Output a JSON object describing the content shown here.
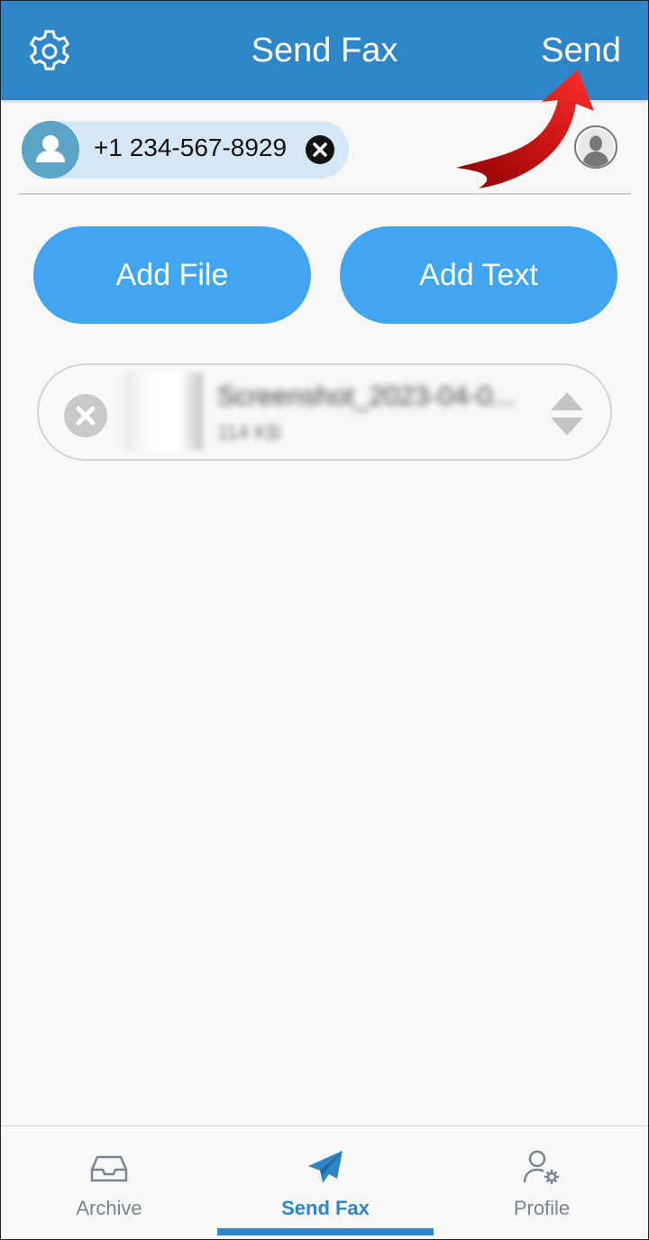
{
  "header": {
    "title": "Send Fax",
    "send_label": "Send",
    "settings_icon": "gear-icon"
  },
  "recipient": {
    "number": "+1 234-567-8929",
    "avatar_icon": "person-icon",
    "remove_icon": "close-icon",
    "contacts_icon": "contact-silhouette-icon"
  },
  "actions": {
    "add_file_label": "Add File",
    "add_text_label": "Add Text"
  },
  "attachments": [
    {
      "name": "Screenshot_2023-04-0...",
      "size": "114 KB",
      "remove_icon": "close-circle-icon",
      "reorder_icon": "reorder-arrows-icon"
    }
  ],
  "bottom_nav": {
    "items": [
      {
        "label": "Archive",
        "icon": "inbox-tray-icon",
        "active": false
      },
      {
        "label": "Send Fax",
        "icon": "paper-plane-icon",
        "active": true
      },
      {
        "label": "Profile",
        "icon": "user-settings-icon",
        "active": false
      }
    ]
  },
  "colors": {
    "header": "#2e86c8",
    "button": "#42a5f0",
    "chip": "#d4e8f7",
    "annotation": "#cc1111"
  }
}
